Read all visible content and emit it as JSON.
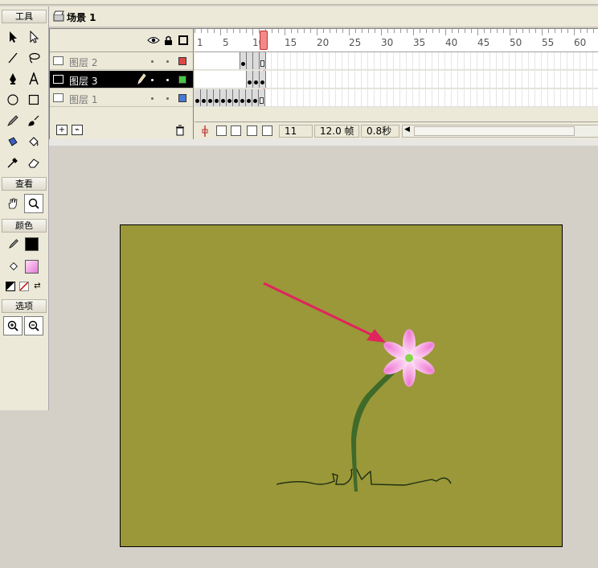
{
  "toolbox": {
    "title": "工具",
    "view_title": "查看",
    "colors_title": "颜色",
    "options_title": "选项",
    "stroke_color": "#000000",
    "fill_color": "#f7a6e6"
  },
  "scene": {
    "name": "场景 1"
  },
  "timeline": {
    "ruler_numbers": [
      "1",
      "5",
      "10",
      "15",
      "20",
      "25",
      "30",
      "35",
      "40",
      "45",
      "50",
      "55",
      "60"
    ],
    "current_frame_indicator": 11,
    "layers": [
      {
        "name": "图层 2",
        "color": "#e04646",
        "selected": false
      },
      {
        "name": "图层 3",
        "color": "#46c846",
        "selected": true
      },
      {
        "name": "图层 1",
        "color": "#4a7ad8",
        "selected": false
      }
    ],
    "status": {
      "frame": "11",
      "fps": "12.0 帧",
      "time": "0.8秒"
    }
  },
  "stage": {
    "background": "#9a9838",
    "flower_color": "#f7a6e6",
    "stem_color": "#3f6a2a",
    "arrow_color": "#e0245e"
  }
}
